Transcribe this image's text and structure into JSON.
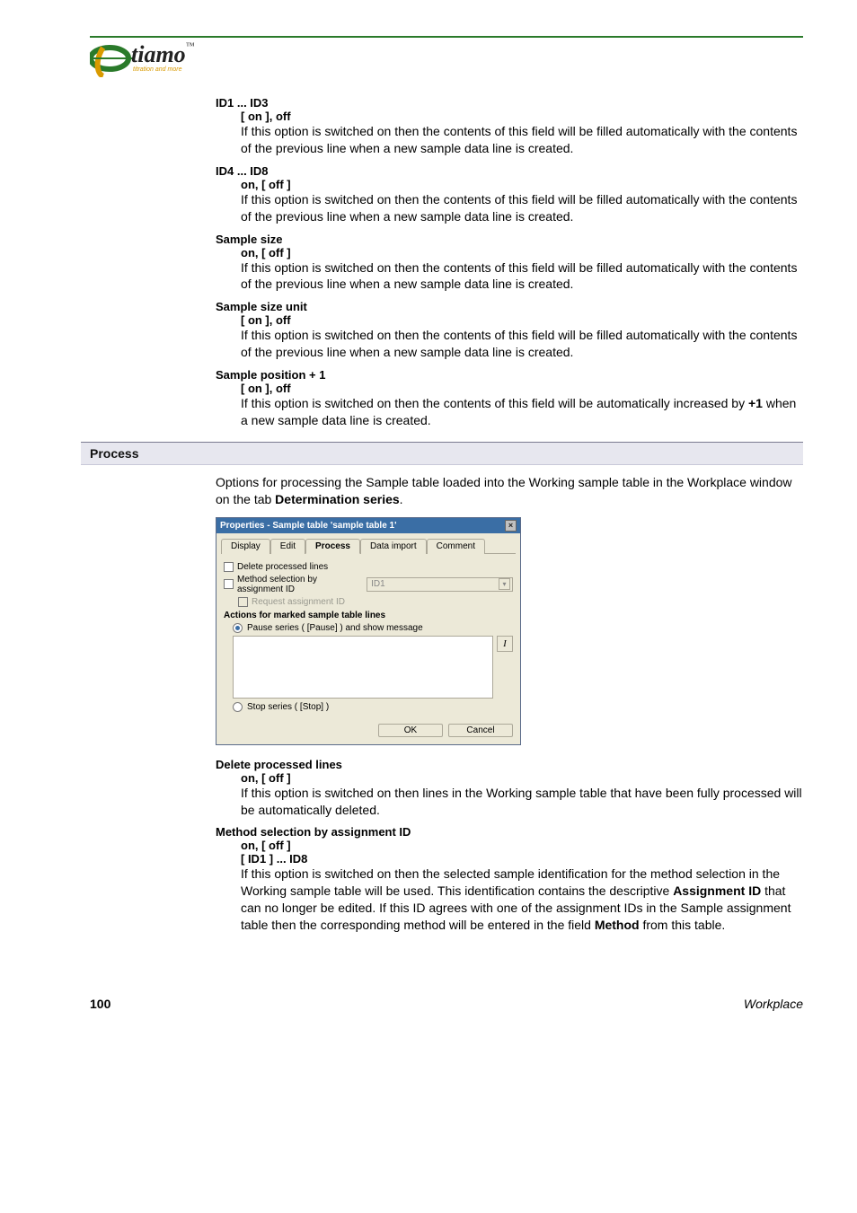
{
  "logo": {
    "brand": "tiamo",
    "tm": "™",
    "tagline": "titration and more"
  },
  "definitions": [
    {
      "head": "ID1 ... ID3",
      "opt": "[ on ], off",
      "desc": "If this option is switched on then the contents of this field will be filled automatically with the contents of the previous line when a new sample data line is created."
    },
    {
      "head": "ID4 ... ID8",
      "opt": "on, [ off ]",
      "desc": "If this option is switched on then the contents of this field will be filled automatically with the contents of the previous line when a new sample data line is created."
    },
    {
      "head": "Sample size",
      "opt": "on, [ off ]",
      "desc": "If this option is switched on then the contents of this field will be filled automatically with the contents of the previous line when a new sample data line is created."
    },
    {
      "head": "Sample size unit",
      "opt": "[ on ], off",
      "desc": "If this option is switched on then the contents of this field will be filled automatically with the contents of the previous line when a new sample data line is created."
    }
  ],
  "sample_pos": {
    "head": "Sample position + 1",
    "opt": "[ on ], off",
    "desc_pre": "If this option is switched on then the contents of this field will be automatically increased by ",
    "bold": "+1",
    "desc_post": " when a new sample data line is created."
  },
  "process": {
    "heading": "Process",
    "intro_pre": "Options for processing the Sample table loaded into the Working sample table in the Workplace window on the tab ",
    "intro_bold": "Determination series",
    "intro_post": "."
  },
  "dialog": {
    "title": "Properties - Sample table 'sample table 1'",
    "tabs": [
      "Display",
      "Edit",
      "Process",
      "Data import",
      "Comment"
    ],
    "active_tab": "Process",
    "chk_delete": "Delete processed lines",
    "chk_method": "Method selection by assignment ID",
    "sel_id": "ID1",
    "chk_request": "Request assignment ID",
    "group_label": "Actions for marked sample table lines",
    "radio_pause": "Pause series ( [Pause] ) and show message",
    "italic_btn": "I",
    "radio_stop": "Stop series ( [Stop] )",
    "ok": "OK",
    "cancel": "Cancel",
    "close": "×"
  },
  "def2": {
    "del": {
      "head": "Delete processed lines",
      "opt": "on, [ off ]",
      "desc": "If this option is switched on then lines in the Working sample table that have been fully processed will be automatically deleted."
    },
    "method": {
      "head": "Method selection by assignment ID",
      "opt": "on, [ off ]",
      "range": "[ ID1 ] ... ID8",
      "desc_pre": "If this option is switched on then the selected sample identification for the method selection in the Working sample table will be used. This identification contains the descriptive ",
      "bold1": "Assignment ID",
      "desc_mid": " that can no longer be edited. If this ID agrees with one of the assignment IDs in the Sample assignment table then the corresponding method will be entered in the field ",
      "bold2": "Method",
      "desc_post": " from this table."
    }
  },
  "footer": {
    "page": "100",
    "section": "Workplace"
  }
}
